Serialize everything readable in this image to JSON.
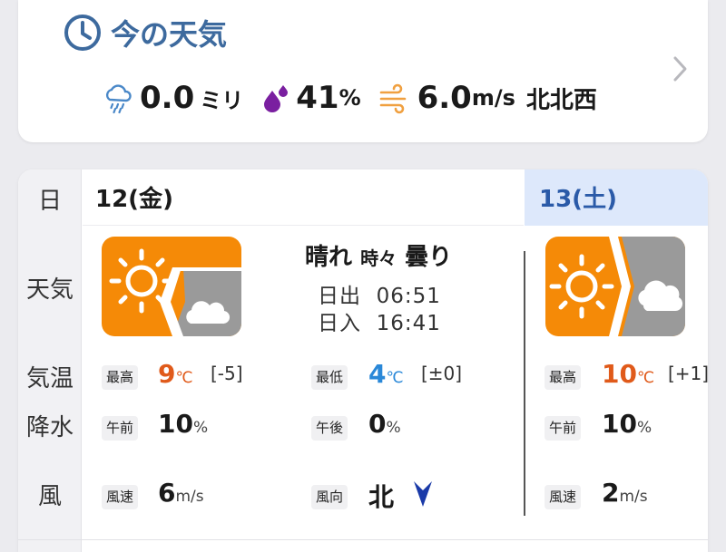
{
  "now": {
    "title": "今の天気",
    "rain_value": "0.0",
    "rain_unit": "ミリ",
    "humidity_value": "41",
    "humidity_unit": "%",
    "wind_value": "6.0",
    "wind_unit": "m/s",
    "wind_dir": "北北西"
  },
  "labels": {
    "day": "日",
    "weather": "天気",
    "temp": "気温",
    "precip": "降水",
    "wind": "風"
  },
  "day1": {
    "date": "12(金)",
    "condition_main": "晴れ",
    "condition_mid": "時々",
    "condition_end": "曇り",
    "sunrise_label": "日出",
    "sunrise": "06:51",
    "sunset_label": "日入",
    "sunset": "16:41",
    "max_label": "最高",
    "max": "9",
    "max_diff": "[-5]",
    "min_label": "最低",
    "min": "4",
    "min_diff": "[±0]",
    "am_label": "午前",
    "am": "10",
    "pm_label": "午後",
    "pm": "0",
    "wind_speed_label": "風速",
    "wind_speed": "6",
    "wind_dir_label": "風向",
    "wind_dir": "北"
  },
  "day2": {
    "date": "13(土)",
    "max_label": "最高",
    "max": "10",
    "max_diff": "[+1]",
    "am_label": "午前",
    "am": "10",
    "wind_speed_label": "風速",
    "wind_speed": "2"
  },
  "units": {
    "celsius": "℃",
    "percent": "%",
    "ms": "m/s"
  },
  "colors": {
    "accent": "#3d6a9e",
    "sun_orange": "#f58a07",
    "cloud_gray": "#9a9a9a",
    "high_temp": "#e05a1a",
    "low_temp": "#2a88d8",
    "humidity_purple": "#7a1fa0",
    "wind_orange": "#f0a040",
    "wind_arrow": "#1a3aa8"
  },
  "icons": {
    "clock": "clock-icon",
    "rain": "rain-cloud-icon",
    "humidity": "droplets-icon",
    "wind": "wind-icon",
    "chevron": "chevron-right-icon",
    "weather": "sun-then-cloud-icon",
    "wind_arrow": "arrow-down-icon"
  }
}
